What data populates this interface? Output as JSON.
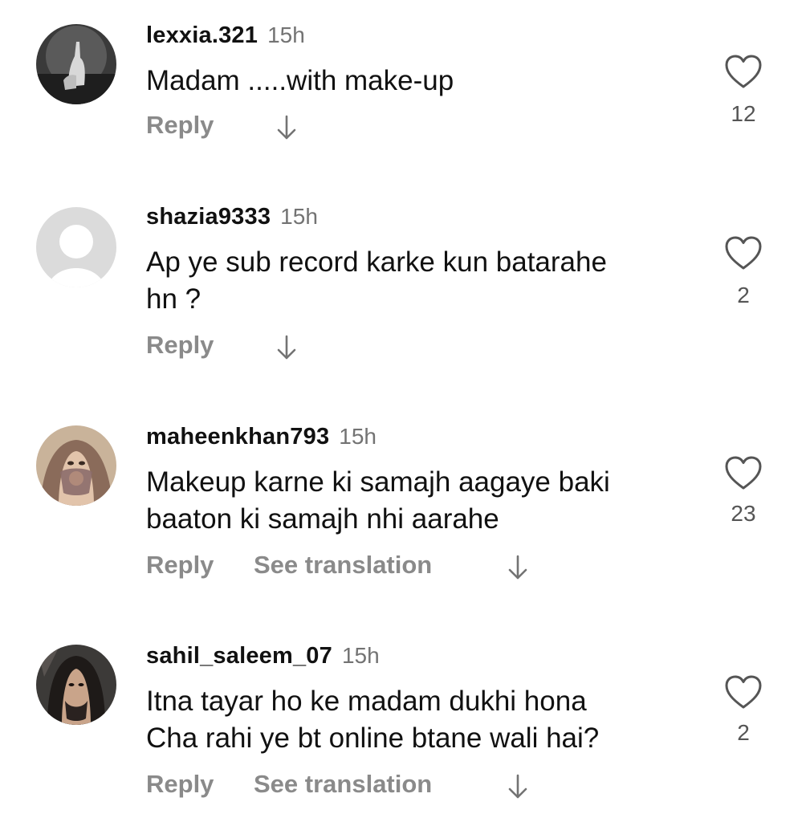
{
  "comments": [
    {
      "username": "lexxia.321",
      "time": "15h",
      "lines": [
        "Madam .....with make-up"
      ],
      "reply_label": "Reply",
      "translate_label": "",
      "likes": "12",
      "avatar_icon": "dark-photo-avatar"
    },
    {
      "username": "shazia9333",
      "time": "15h",
      "lines": [
        "Ap ye sub record karke kun batarahe",
        "hn ?"
      ],
      "reply_label": "Reply",
      "translate_label": "",
      "likes": "2",
      "avatar_icon": "default-user-avatar"
    },
    {
      "username": "maheenkhan793",
      "time": "15h",
      "lines": [
        "Makeup karne ki samajh aagaye baki",
        "baaton ki samajh nhi aarahe"
      ],
      "reply_label": "Reply",
      "translate_label": "See translation",
      "likes": "23",
      "avatar_icon": "veiled-woman-avatar"
    },
    {
      "username": "sahil_saleem_07",
      "time": "15h",
      "lines": [
        "Itna tayar ho ke madam dukhi hona",
        "Cha rahi ye bt online btane wali hai?"
      ],
      "reply_label": "Reply",
      "translate_label": "See translation",
      "likes": "2",
      "avatar_icon": "long-hair-man-avatar"
    }
  ],
  "colors": {
    "text": "#111111",
    "secondary": "#737373",
    "action": "#8a8a8a",
    "background": "#ffffff"
  }
}
